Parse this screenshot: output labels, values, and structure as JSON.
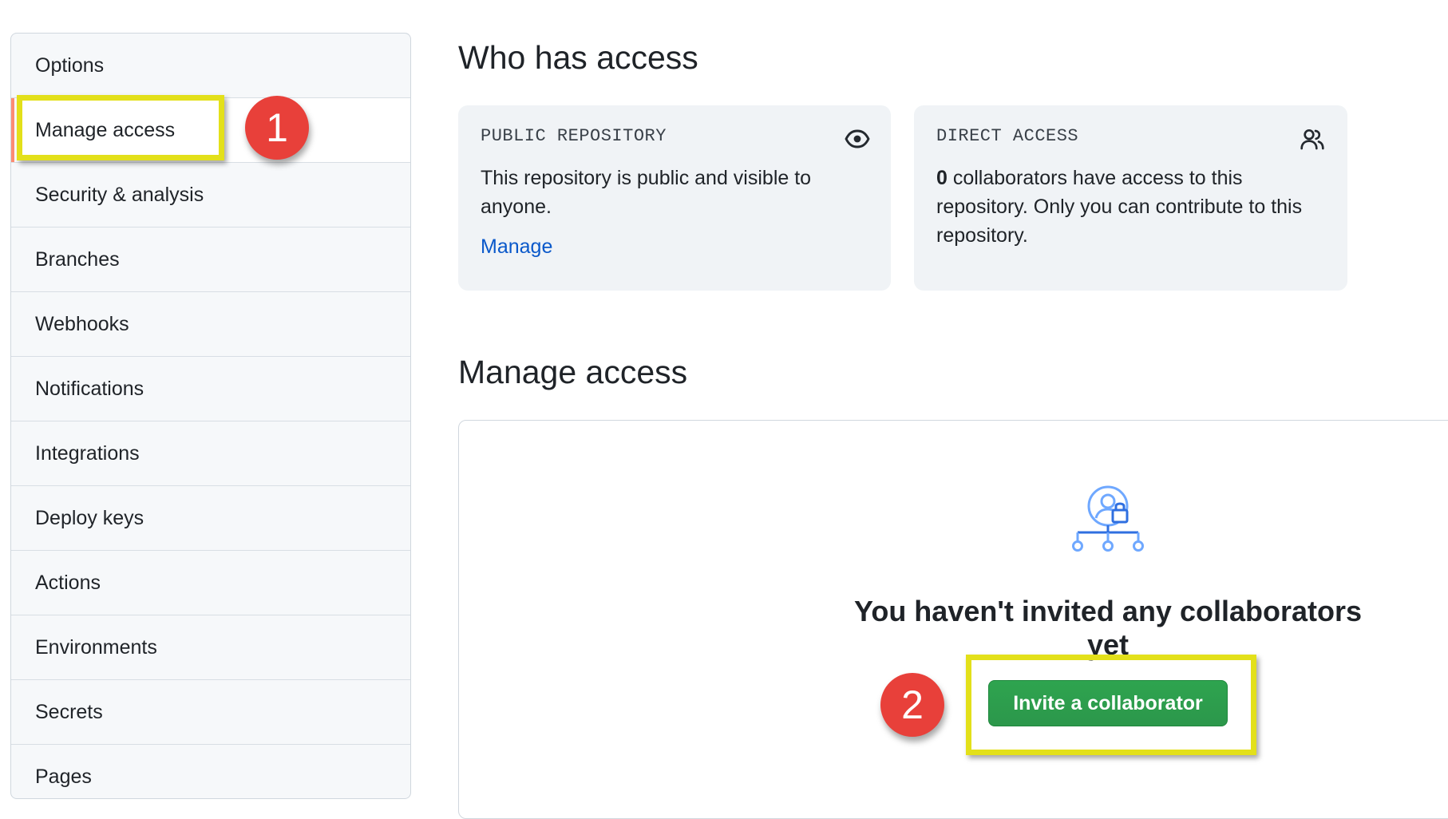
{
  "sidebar": {
    "items": [
      {
        "label": "Options"
      },
      {
        "label": "Manage access"
      },
      {
        "label": "Security & analysis"
      },
      {
        "label": "Branches"
      },
      {
        "label": "Webhooks"
      },
      {
        "label": "Notifications"
      },
      {
        "label": "Integrations"
      },
      {
        "label": "Deploy keys"
      },
      {
        "label": "Actions"
      },
      {
        "label": "Environments"
      },
      {
        "label": "Secrets"
      },
      {
        "label": "Pages"
      }
    ]
  },
  "who_has_access": {
    "title": "Who has access",
    "public_card": {
      "label": "PUBLIC REPOSITORY",
      "text": "This repository is public and visible to anyone.",
      "link": "Manage",
      "icon": "eye-icon"
    },
    "direct_card": {
      "label": "DIRECT ACCESS",
      "count": "0",
      "text": " collaborators have access to this repository. Only you can contribute to this repository.",
      "icon": "people-icon"
    }
  },
  "manage_access": {
    "title": "Manage access",
    "empty_title": "You haven't invited any collaborators yet",
    "invite_button": "Invite a collaborator",
    "illustration": "collaborator-lock-illustration"
  },
  "annotations": {
    "step1": "1",
    "step2": "2"
  },
  "colors": {
    "accent_link": "#0a58ca",
    "button_green": "#2da44e",
    "highlight_yellow": "#e3e01a",
    "marker_red": "#e8403a",
    "selected_bar": "#fd8c73"
  }
}
